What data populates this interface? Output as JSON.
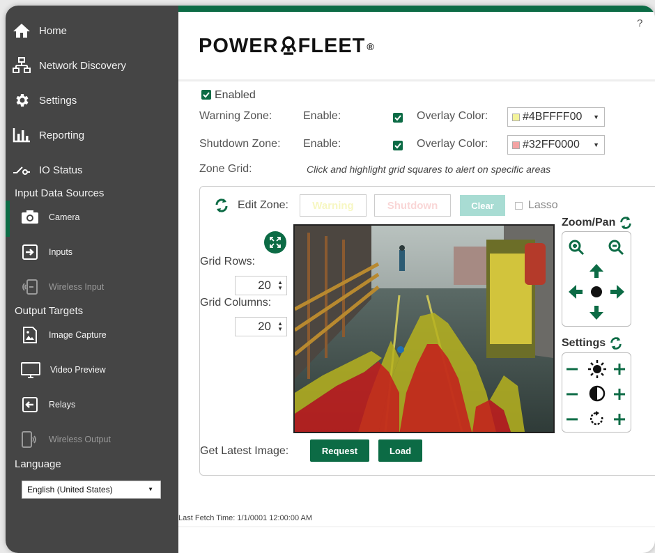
{
  "sidebar": {
    "nav": [
      {
        "label": "Home",
        "icon": "home-icon"
      },
      {
        "label": "Network Discovery",
        "icon": "network-icon"
      },
      {
        "label": "Settings",
        "icon": "gear-icon"
      },
      {
        "label": "Reporting",
        "icon": "bar-chart-icon"
      },
      {
        "label": "IO Status",
        "icon": "switch-icon"
      }
    ],
    "input_section": "Input Data Sources",
    "inputs": [
      {
        "label": "Camera",
        "icon": "camera-icon",
        "active": true
      },
      {
        "label": "Inputs",
        "icon": "input-arrow-icon"
      },
      {
        "label": "Wireless Input",
        "icon": "wireless-input-icon",
        "disabled": true
      }
    ],
    "output_section": "Output Targets",
    "outputs": [
      {
        "label": "Image Capture",
        "icon": "image-icon"
      },
      {
        "label": "Video Preview",
        "icon": "monitor-icon"
      },
      {
        "label": "Relays",
        "icon": "relay-icon"
      },
      {
        "label": "Wireless Output",
        "icon": "wireless-output-icon",
        "disabled": true
      }
    ],
    "language_label": "Language",
    "language_value": "English (United States)"
  },
  "header": {
    "brand_left": "POWER",
    "brand_right": "FLEET",
    "brand_mark": "®",
    "help": "?"
  },
  "form": {
    "enabled_label": "Enabled",
    "warning_zone_label": "Warning Zone:",
    "shutdown_zone_label": "Shutdown Zone:",
    "enable_label": "Enable:",
    "overlay_color_label": "Overlay Color:",
    "warning_color": "#4BFFFF00",
    "shutdown_color": "#32FF0000",
    "zone_grid_label": "Zone Grid:",
    "zone_grid_hint": "Click and highlight grid squares to alert on specific areas"
  },
  "editor": {
    "edit_zone_label": "Edit Zone:",
    "warning_button": "Warning",
    "shutdown_button": "Shutdown",
    "clear_button": "Clear",
    "lasso_label": "Lasso",
    "grid_rows_label": "Grid Rows:",
    "grid_rows_value": "20",
    "grid_columns_label": "Grid Columns:",
    "grid_columns_value": "20",
    "zoom_pan_label": "Zoom/Pan",
    "settings_label": "Settings",
    "get_latest_label": "Get Latest Image:",
    "request_button": "Request",
    "load_button": "Load"
  },
  "footer": {
    "last_fetch": "Last Fetch Time: 1/1/0001 12:00:00 AM"
  },
  "colors": {
    "brand_green": "#0c6b45",
    "sidebar_bg": "#454545",
    "warning_overlay": "#FFFF00",
    "shutdown_overlay": "#FF0000"
  }
}
